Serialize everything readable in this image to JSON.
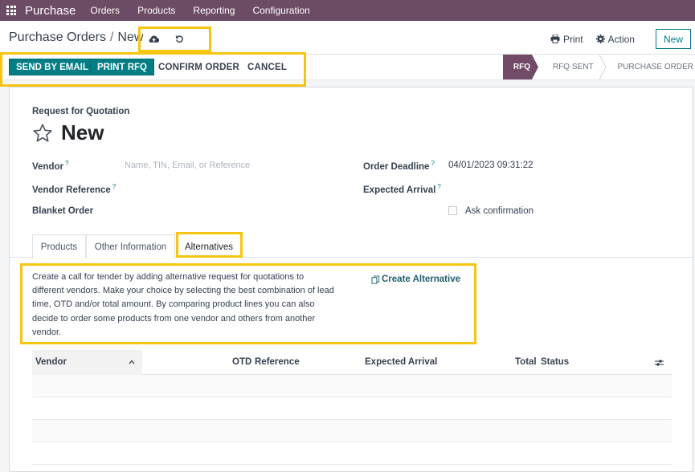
{
  "navbar": {
    "brand": "Purchase",
    "menu": [
      "Orders",
      "Products",
      "Reporting",
      "Configuration"
    ],
    "apps_icon": "grid-icon",
    "background": "#6c4b65"
  },
  "control_panel": {
    "breadcrumb_parent": "Purchase Orders",
    "breadcrumb_separator": "/",
    "breadcrumb_current": "New",
    "save_icon": "cloud-upload-icon",
    "discard_icon": "undo-icon",
    "print_label": "Print",
    "action_label": "Action",
    "new_label": "New"
  },
  "statusbar": {
    "buttons": {
      "send_by_email": "SEND BY EMAIL",
      "print_rfq": "PRINT RFQ",
      "confirm_order": "CONFIRM ORDER",
      "cancel": "CANCEL"
    },
    "stages": [
      {
        "label": "RFQ",
        "active": true
      },
      {
        "label": "RFQ SENT",
        "active": false
      },
      {
        "label": "PURCHASE ORDER",
        "active": false
      }
    ],
    "accent": "#017e84",
    "stage_active_color": "#714b67"
  },
  "form": {
    "subtitle": "Request for Quotation",
    "title": "New",
    "fields": {
      "vendor": {
        "label": "Vendor",
        "help": "?",
        "placeholder": "Name, TIN, Email, or Reference",
        "value": ""
      },
      "vendor_reference": {
        "label": "Vendor Reference",
        "help": "?",
        "value": ""
      },
      "blanket_order": {
        "label": "Blanket Order",
        "value": ""
      },
      "order_deadline": {
        "label": "Order Deadline",
        "help": "?",
        "value": "04/01/2023 09:31:22"
      },
      "expected_arrival": {
        "label": "Expected Arrival",
        "help": "?",
        "value": ""
      },
      "ask_confirmation": {
        "label": "Ask confirmation",
        "checked": false
      }
    }
  },
  "tabs": [
    {
      "label": "Products",
      "active": false
    },
    {
      "label": "Other Information",
      "active": false
    },
    {
      "label": "Alternatives",
      "active": true
    }
  ],
  "alternatives": {
    "help_text": "Create a call for tender by adding alternative request for quotations to different vendors. Make your choice by selecting the best combination of lead time, OTD and/or total amount. By comparing product lines you can also decide to order some products from one vendor and others from another vendor.",
    "create_alternative_label": "Create Alternative",
    "table": {
      "columns": [
        "Vendor",
        "OTD",
        "Reference",
        "Expected Arrival",
        "Total",
        "Status"
      ],
      "sort_column": "Vendor",
      "sort_direction": "ascending",
      "rows": []
    }
  },
  "highlight_color": "#f6c512"
}
